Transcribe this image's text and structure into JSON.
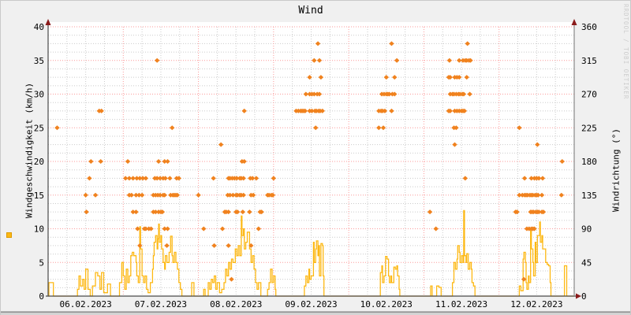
{
  "title": "Wind",
  "watermark": "RRDTOOL / TOBI OETIKER",
  "colors": {
    "background": "#F0F0F0",
    "plot_background": "#FFFFFF",
    "grid_major": "#FC9A9A",
    "grid_minor": "#CBCBCB",
    "axis": "#4A4A4A",
    "right_axis_line": "#8A8A8A",
    "arrow": "#8B1B1B",
    "speed_line": "#FDB813",
    "direction_marker": "#F0821E",
    "watermark_text": "#CDCDCD"
  },
  "chart_data": {
    "type": "line",
    "title": "Wind",
    "grid": "on",
    "x_axis": {
      "tick_labels": [
        "06.02.2023",
        "07.02.2023",
        "08.02.2023",
        "09.02.2023",
        "10.02.2023",
        "11.02.2023",
        "12.02.2023"
      ],
      "days": 7,
      "minor_per_day": 4
    },
    "left_axis": {
      "label": "Windgeschwindigkeit (km/h)",
      "min": 0,
      "max": 40,
      "tick_step": 5,
      "minor_step": 1.25,
      "tick_labels": [
        "0",
        "5",
        "10",
        "15",
        "20",
        "25",
        "30",
        "35",
        "40"
      ]
    },
    "right_axis": {
      "label": "Windrichtung (°)",
      "min": 0,
      "max": 360,
      "tick_step": 45,
      "tick_labels": [
        "0",
        "45",
        "90",
        "135",
        "180",
        "225",
        "270",
        "315",
        "360"
      ]
    },
    "series": [
      {
        "name": "Windgeschwindigkeit",
        "unit": "km/h",
        "axis": "left",
        "style": "step-line",
        "color": "#FDB813",
        "points": [
          [
            0,
            0
          ],
          [
            0.01,
            2
          ],
          [
            0.07,
            0
          ],
          [
            0.39,
            1
          ],
          [
            0.41,
            3
          ],
          [
            0.43,
            1.5
          ],
          [
            0.46,
            2.5
          ],
          [
            0.48,
            1
          ],
          [
            0.5,
            4
          ],
          [
            0.53,
            1
          ],
          [
            0.56,
            0
          ],
          [
            0.59,
            1.5
          ],
          [
            0.63,
            3.5
          ],
          [
            0.66,
            3
          ],
          [
            0.69,
            1
          ],
          [
            0.71,
            3.5
          ],
          [
            0.74,
            0.5
          ],
          [
            0.79,
            1.8
          ],
          [
            0.83,
            0
          ],
          [
            0.95,
            2
          ],
          [
            0.98,
            5
          ],
          [
            1,
            3
          ],
          [
            1.02,
            1
          ],
          [
            1.04,
            4
          ],
          [
            1.06,
            2
          ],
          [
            1.08,
            3
          ],
          [
            1.1,
            6
          ],
          [
            1.12,
            6.5
          ],
          [
            1.14,
            6
          ],
          [
            1.17,
            5
          ],
          [
            1.18,
            3
          ],
          [
            1.2,
            2
          ],
          [
            1.22,
            10.3
          ],
          [
            1.23,
            7
          ],
          [
            1.25,
            3
          ],
          [
            1.27,
            2
          ],
          [
            1.29,
            3
          ],
          [
            1.31,
            1
          ],
          [
            1.33,
            0.5
          ],
          [
            1.36,
            2
          ],
          [
            1.39,
            4
          ],
          [
            1.4,
            6
          ],
          [
            1.41,
            8
          ],
          [
            1.43,
            9
          ],
          [
            1.45,
            7
          ],
          [
            1.46,
            8.5
          ],
          [
            1.47,
            10.7
          ],
          [
            1.48,
            8
          ],
          [
            1.5,
            9
          ],
          [
            1.51,
            7
          ],
          [
            1.53,
            5
          ],
          [
            1.55,
            4
          ],
          [
            1.56,
            6
          ],
          [
            1.58,
            5
          ],
          [
            1.61,
            6.5
          ],
          [
            1.63,
            8.9
          ],
          [
            1.65,
            6
          ],
          [
            1.66,
            5
          ],
          [
            1.68,
            6.5
          ],
          [
            1.7,
            5
          ],
          [
            1.72,
            4
          ],
          [
            1.74,
            2
          ],
          [
            1.76,
            1
          ],
          [
            1.78,
            0
          ],
          [
            1.91,
            2
          ],
          [
            1.94,
            0
          ],
          [
            2.07,
            1
          ],
          [
            2.09,
            0
          ],
          [
            2.13,
            2
          ],
          [
            2.15,
            1
          ],
          [
            2.17,
            2.5
          ],
          [
            2.19,
            2
          ],
          [
            2.21,
            3
          ],
          [
            2.23,
            1
          ],
          [
            2.25,
            2
          ],
          [
            2.28,
            0.5
          ],
          [
            2.31,
            1
          ],
          [
            2.34,
            2
          ],
          [
            2.36,
            4
          ],
          [
            2.38,
            3
          ],
          [
            2.4,
            5
          ],
          [
            2.42,
            4
          ],
          [
            2.44,
            5.5
          ],
          [
            2.46,
            5
          ],
          [
            2.49,
            7
          ],
          [
            2.51,
            6
          ],
          [
            2.53,
            7.5
          ],
          [
            2.55,
            6
          ],
          [
            2.57,
            11.9
          ],
          [
            2.58,
            9
          ],
          [
            2.6,
            10
          ],
          [
            2.61,
            7
          ],
          [
            2.63,
            8
          ],
          [
            2.65,
            9.5
          ],
          [
            2.68,
            7
          ],
          [
            2.7,
            5
          ],
          [
            2.72,
            6
          ],
          [
            2.74,
            4
          ],
          [
            2.76,
            2
          ],
          [
            2.78,
            1
          ],
          [
            2.8,
            2
          ],
          [
            2.83,
            0
          ],
          [
            2.92,
            1
          ],
          [
            2.94,
            2
          ],
          [
            2.96,
            4
          ],
          [
            2.98,
            2
          ],
          [
            3,
            3
          ],
          [
            3.02,
            1
          ],
          [
            3.03,
            0
          ],
          [
            3.41,
            1.5
          ],
          [
            3.43,
            3
          ],
          [
            3.45,
            2
          ],
          [
            3.47,
            4
          ],
          [
            3.48,
            2.5
          ],
          [
            3.5,
            3
          ],
          [
            3.53,
            8
          ],
          [
            3.54,
            5
          ],
          [
            3.56,
            7
          ],
          [
            3.57,
            8.2
          ],
          [
            3.59,
            6
          ],
          [
            3.6,
            7.5
          ],
          [
            3.61,
            3
          ],
          [
            3.63,
            7.8
          ],
          [
            3.65,
            7.5
          ],
          [
            3.66,
            3
          ],
          [
            3.67,
            0
          ],
          [
            4.42,
            3.5
          ],
          [
            4.44,
            4.5
          ],
          [
            4.45,
            2
          ],
          [
            4.47,
            3
          ],
          [
            4.49,
            5.9
          ],
          [
            4.51,
            5.5
          ],
          [
            4.53,
            3
          ],
          [
            4.54,
            2
          ],
          [
            4.56,
            3
          ],
          [
            4.57,
            2
          ],
          [
            4.6,
            4.3
          ],
          [
            4.62,
            4
          ],
          [
            4.64,
            4.5
          ],
          [
            4.65,
            3
          ],
          [
            4.67,
            1
          ],
          [
            4.68,
            0
          ],
          [
            5.09,
            1.5
          ],
          [
            5.11,
            0
          ],
          [
            5.17,
            1.5
          ],
          [
            5.2,
            1.3
          ],
          [
            5.23,
            0
          ],
          [
            5.38,
            2
          ],
          [
            5.4,
            5
          ],
          [
            5.42,
            4
          ],
          [
            5.44,
            5.5
          ],
          [
            5.45,
            7.5
          ],
          [
            5.47,
            6.5
          ],
          [
            5.48,
            5
          ],
          [
            5.5,
            6
          ],
          [
            5.52,
            5
          ],
          [
            5.53,
            12.7
          ],
          [
            5.54,
            6
          ],
          [
            5.56,
            5
          ],
          [
            5.57,
            6.3
          ],
          [
            5.59,
            4
          ],
          [
            5.61,
            5
          ],
          [
            5.63,
            4
          ],
          [
            5.64,
            2
          ],
          [
            5.66,
            1.5
          ],
          [
            5.68,
            0
          ],
          [
            6.27,
            1.5
          ],
          [
            6.29,
            0.8
          ],
          [
            6.32,
            5.5
          ],
          [
            6.33,
            6.5
          ],
          [
            6.35,
            5
          ],
          [
            6.36,
            2
          ],
          [
            6.37,
            1
          ],
          [
            6.39,
            3
          ],
          [
            6.4,
            2
          ],
          [
            6.42,
            9.8
          ],
          [
            6.43,
            7
          ],
          [
            6.45,
            5
          ],
          [
            6.46,
            3
          ],
          [
            6.48,
            8
          ],
          [
            6.49,
            5
          ],
          [
            6.51,
            9
          ],
          [
            6.54,
            11
          ],
          [
            6.55,
            8
          ],
          [
            6.57,
            9
          ],
          [
            6.58,
            7
          ],
          [
            6.6,
            7
          ],
          [
            6.62,
            5
          ],
          [
            6.64,
            4.7
          ],
          [
            6.66,
            4.5
          ],
          [
            6.68,
            2
          ],
          [
            6.69,
            0
          ],
          [
            6.87,
            4.5
          ],
          [
            6.9,
            0
          ],
          [
            7,
            0
          ]
        ]
      },
      {
        "name": "Windrichtung",
        "unit": "°",
        "axis": "right",
        "style": "scatter-diamond",
        "color": "#F0821E",
        "groups": [
          {
            "deg": 337.5,
            "t": [
              3.59,
              4.57,
              5.58
            ]
          },
          {
            "deg": 315,
            "t": [
              1.45,
              3.54,
              3.61,
              4.64,
              5.34,
              5.47,
              5.52,
              5.55,
              5.57,
              5.6,
              5.62
            ]
          },
          {
            "deg": 292.5,
            "t": [
              3.48,
              3.63,
              4.5,
              4.61,
              5.33,
              5.35,
              5.41,
              5.44,
              5.47,
              5.57
            ]
          },
          {
            "deg": 270,
            "t": [
              3.43,
              3.48,
              3.51,
              3.54,
              3.58,
              3.61,
              4.44,
              4.47,
              4.5,
              4.52,
              4.54,
              4.58,
              4.61,
              5.35,
              5.38,
              5.4,
              5.43,
              5.46,
              5.48,
              5.51,
              5.53,
              5.61
            ]
          },
          {
            "deg": 247.5,
            "t": [
              0.68,
              0.71,
              2.61,
              3.3,
              3.33,
              3.36,
              3.38,
              3.4,
              3.42,
              3.48,
              3.51,
              3.55,
              3.57,
              3.6,
              3.62,
              3.65,
              4.4,
              4.43,
              4.45,
              4.48,
              4.57,
              5.33,
              5.35,
              5.41,
              5.44,
              5.47,
              5.5,
              5.52,
              5.54
            ]
          },
          {
            "deg": 225,
            "t": [
              0.12,
              1.65,
              3.56,
              4.4,
              4.46,
              5.4,
              5.43,
              6.27
            ]
          },
          {
            "deg": 202.5,
            "t": [
              2.3,
              5.41,
              6.51
            ]
          },
          {
            "deg": 180,
            "t": [
              0.57,
              0.7,
              1.06,
              1.47,
              1.55,
              1.59,
              2.58,
              2.61,
              6.84
            ]
          },
          {
            "deg": 157.5,
            "t": [
              0.55,
              1.03,
              1.08,
              1.13,
              1.18,
              1.22,
              1.26,
              1.3,
              1.42,
              1.45,
              1.49,
              1.53,
              1.56,
              1.62,
              1.71,
              1.74,
              2.2,
              2.4,
              2.42,
              2.45,
              2.48,
              2.51,
              2.55,
              2.57,
              2.6,
              2.69,
              2.72,
              2.77,
              3,
              5.55,
              6.34,
              6.43,
              6.47,
              6.5,
              6.53,
              6.58
            ]
          },
          {
            "deg": 135,
            "t": [
              0.5,
              0.63,
              1.08,
              1.11,
              1.17,
              1.21,
              1.25,
              1.4,
              1.43,
              1.46,
              1.49,
              1.53,
              1.55,
              1.63,
              1.66,
              1.68,
              1.7,
              1.72,
              2,
              2.39,
              2.42,
              2.46,
              2.5,
              2.52,
              2.55,
              2.57,
              2.6,
              2.7,
              2.73,
              2.92,
              2.94,
              2.97,
              2.99,
              6.27,
              6.31,
              6.34,
              6.36,
              6.38,
              6.41,
              6.43,
              6.45,
              6.48,
              6.5,
              6.52,
              6.57,
              6.83
            ]
          },
          {
            "deg": 112.5,
            "t": [
              0.51,
              1.13,
              1.17,
              1.4,
              1.43,
              1.47,
              1.5,
              1.52,
              2.35,
              2.37,
              2.4,
              2.5,
              2.52,
              2.59,
              2.68,
              2.82,
              2.84,
              5.08,
              6.22,
              6.24,
              6.42,
              6.44,
              6.46,
              6.49,
              6.51,
              6.53,
              6.57,
              6.59
            ]
          },
          {
            "deg": 90,
            "t": [
              1.19,
              1.28,
              1.3,
              1.34,
              1.37,
              1.55,
              1.59,
              2.07,
              2.32,
              2.8,
              5.16,
              6.37,
              6.4,
              6.43,
              6.45,
              6.47
            ]
          },
          {
            "deg": 67.5,
            "t": [
              1.22,
              1.58,
              2.21,
              2.4,
              2.7
            ]
          },
          {
            "deg": 22.5,
            "t": [
              2.44,
              6.33
            ]
          }
        ]
      }
    ]
  }
}
